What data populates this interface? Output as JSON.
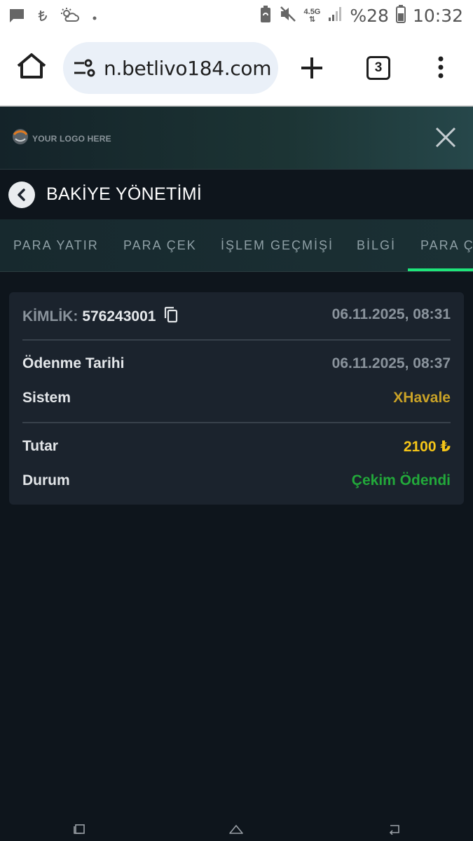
{
  "status_bar": {
    "network_type": "4.5G",
    "battery_percent": "%28",
    "time": "10:32"
  },
  "browser": {
    "url": "n.betlivo184.com",
    "tab_count": "3"
  },
  "site": {
    "logo_text": "YOUR LOGO HERE"
  },
  "page": {
    "title": "BAKİYE YÖNETİMİ"
  },
  "tabs": [
    {
      "label": "PARA YATIR"
    },
    {
      "label": "PARA ÇEK"
    },
    {
      "label": "İŞLEM GEÇMİŞİ"
    },
    {
      "label": "BİLGİ"
    },
    {
      "label": "PARA Ç"
    }
  ],
  "transaction": {
    "id_label": "KİMLİK:",
    "id_value": "576243001",
    "created": "06.11.2025, 08:31",
    "payment_date_label": "Ödenme Tarihi",
    "payment_date_value": "06.11.2025, 08:37",
    "system_label": "Sistem",
    "system_value": "XHavale",
    "amount_label": "Tutar",
    "amount_value": "2100 ₺",
    "status_label": "Durum",
    "status_value": "Çekim Ödendi"
  },
  "colors": {
    "system": "#c9a227",
    "amount": "#f5c518",
    "status": "#22a83a",
    "tab_active": "#1ee57a"
  }
}
